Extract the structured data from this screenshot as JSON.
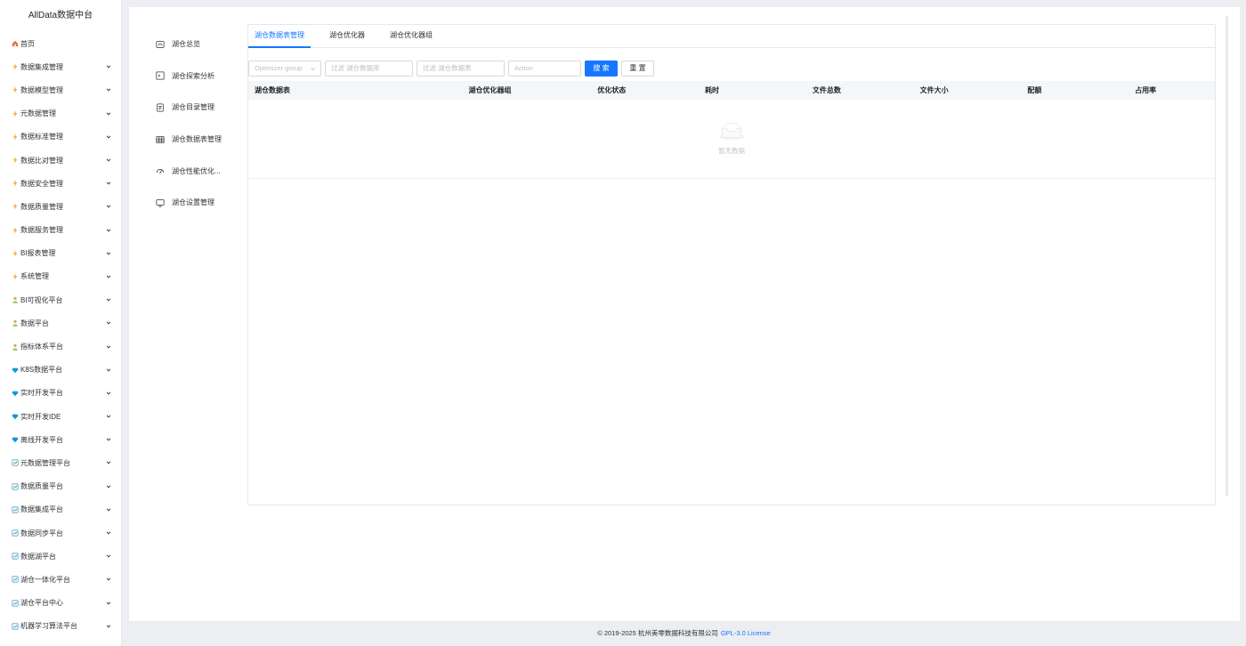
{
  "app": {
    "title": "AllData数据中台"
  },
  "sidebar": {
    "items": [
      {
        "label": "首页",
        "icon": "home-icon",
        "expandable": false
      },
      {
        "label": "数据集成管理",
        "icon": "lightning-icon",
        "expandable": true
      },
      {
        "label": "数据模型管理",
        "icon": "lightning-icon",
        "expandable": true
      },
      {
        "label": "元数据管理",
        "icon": "lightning-icon",
        "expandable": true
      },
      {
        "label": "数据标准管理",
        "icon": "lightning-icon",
        "expandable": true
      },
      {
        "label": "数据比对管理",
        "icon": "lightning-icon",
        "expandable": true
      },
      {
        "label": "数据安全管理",
        "icon": "lightning-icon",
        "expandable": true
      },
      {
        "label": "数据质量管理",
        "icon": "lightning-icon",
        "expandable": true
      },
      {
        "label": "数据服务管理",
        "icon": "lightning-icon",
        "expandable": true
      },
      {
        "label": "BI报表管理",
        "icon": "lightning-icon",
        "expandable": true
      },
      {
        "label": "系统管理",
        "icon": "lightning-icon",
        "expandable": true
      },
      {
        "label": "BI可视化平台",
        "icon": "person-icon",
        "expandable": true
      },
      {
        "label": "数据平台",
        "icon": "person-icon",
        "expandable": true
      },
      {
        "label": "指标体系平台",
        "icon": "person-icon",
        "expandable": true
      },
      {
        "label": "K8S数据平台",
        "icon": "diamond-icon",
        "expandable": true
      },
      {
        "label": "实时开发平台",
        "icon": "diamond-icon",
        "expandable": true
      },
      {
        "label": "实时开发IDE",
        "icon": "diamond-icon",
        "expandable": true
      },
      {
        "label": "离线开发平台",
        "icon": "diamond-icon",
        "expandable": true
      },
      {
        "label": "元数据管理平台",
        "icon": "chart-icon",
        "expandable": true
      },
      {
        "label": "数据质量平台",
        "icon": "chart-icon",
        "expandable": true
      },
      {
        "label": "数据集成平台",
        "icon": "chart-icon",
        "expandable": true
      },
      {
        "label": "数据同步平台",
        "icon": "chart-icon",
        "expandable": true
      },
      {
        "label": "数据湖平台",
        "icon": "chart-icon",
        "expandable": true
      },
      {
        "label": "湖仓一体化平台",
        "icon": "chart-icon",
        "expandable": true
      },
      {
        "label": "湖仓平台中心",
        "icon": "chart-icon",
        "expandable": true
      },
      {
        "label": "机器学习算法平台",
        "icon": "chart-icon",
        "expandable": true
      }
    ]
  },
  "submenu": {
    "items": [
      {
        "label": "湖仓总览",
        "icon": "dashboard-icon"
      },
      {
        "label": "湖仓探索分析",
        "icon": "terminal-icon"
      },
      {
        "label": "湖仓目录管理",
        "icon": "document-icon"
      },
      {
        "label": "湖仓数据表管理",
        "icon": "table-icon"
      },
      {
        "label": "湖仓性能优化...",
        "icon": "gauge-icon"
      },
      {
        "label": "湖仓设置管理",
        "icon": "monitor-icon"
      }
    ]
  },
  "tabs": [
    {
      "label": "湖仓数据表管理",
      "active": true
    },
    {
      "label": "湖仓优化器",
      "active": false
    },
    {
      "label": "湖仓优化器组",
      "active": false
    }
  ],
  "filters": {
    "optimizer_group": {
      "placeholder": "Optimizer group"
    },
    "database": {
      "placeholder": "过滤 湖仓数据库"
    },
    "table": {
      "placeholder": "过滤 湖仓数据表"
    },
    "action": {
      "placeholder": "Action"
    },
    "search_label": "搜 索",
    "reset_label": "重 置"
  },
  "table": {
    "columns": [
      "湖仓数据表",
      "湖仓优化器组",
      "优化状态",
      "耗时",
      "文件总数",
      "文件大小",
      "配额",
      "占用率"
    ],
    "rows": [],
    "empty_text": "暂无数据"
  },
  "footer": {
    "copyright": "© 2019-2025 杭州美零数据科技有限公司",
    "license": "GPL-3.0 License"
  },
  "colors": {
    "accent": "#1677ff",
    "lightning": "#f5a623",
    "diamond": "#1296db",
    "person": "#8bc34a"
  }
}
